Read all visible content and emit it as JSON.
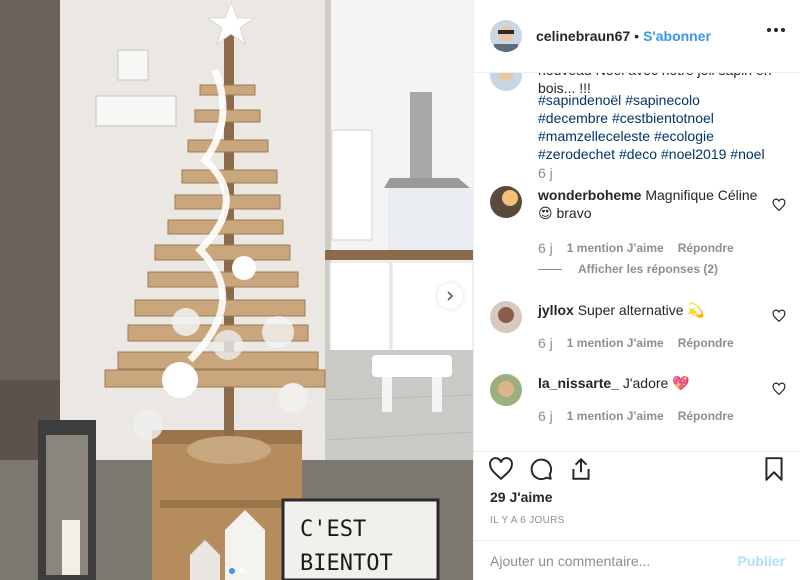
{
  "post": {
    "username": "celinebraun67",
    "separator": "•",
    "follow_label": "S'abonner",
    "more_icon": "more-options-icon"
  },
  "caption": {
    "cut_line": "nouveau Noël avec notre joli sapin en bois... !!!",
    "tags": [
      "#sapindenoël",
      "#sapinecolo",
      "#decembre",
      "#cestbientotnoel",
      "#mamzelleceleste",
      "#ecologie",
      "#zerodechet",
      "#deco",
      "#noel2019",
      "#noel"
    ],
    "time": "6 j"
  },
  "comments": [
    {
      "user": "wonderboheme",
      "text": "Magnifique Céline 😍 bravo",
      "time": "6 j",
      "likes": "1 mention J'aime",
      "reply": "Répondre",
      "view_replies": "Afficher les réponses (2)"
    },
    {
      "user": "jyllox",
      "text": "Super alternative 💫",
      "time": "6 j",
      "likes": "1 mention J'aime",
      "reply": "Répondre"
    },
    {
      "user": "la_nissarte_",
      "text": "J'adore 💖",
      "time": "6 j",
      "likes": "1 mention J'aime",
      "reply": "Répondre"
    }
  ],
  "actions": {
    "like_icon": "heart-icon",
    "comment_icon": "comment-icon",
    "share_icon": "share-icon",
    "save_icon": "bookmark-icon",
    "likes_text": "29 J'aime",
    "date_text": "IL Y A 6 JOURS"
  },
  "add_comment": {
    "placeholder": "Ajouter un commentaire...",
    "publish_label": "Publier"
  },
  "photo": {
    "sign_line1": "C'EST",
    "sign_line2": "BIENTOT",
    "carousel": {
      "count": 2,
      "active": 1
    }
  },
  "colors": {
    "link_blue": "#3897f0",
    "hashtag": "#003569",
    "muted": "#8e8e8e",
    "publish_disabled": "#b2dffc"
  }
}
